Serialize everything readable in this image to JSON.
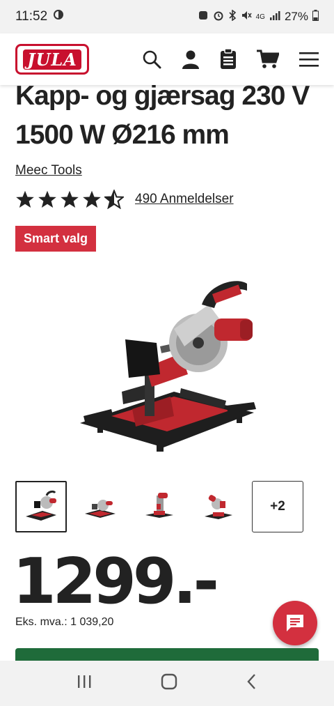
{
  "status_bar": {
    "time": "11:52",
    "network": "4G",
    "battery": "27%"
  },
  "header": {
    "logo_text": "JULA",
    "icons": [
      "search-icon",
      "user-icon",
      "clipboard-icon",
      "cart-icon",
      "menu-icon"
    ]
  },
  "product": {
    "title": "Kapp- og gjærsag 230 V 1500 W Ø216 mm",
    "brand": "Meec Tools",
    "rating_stars": 4.5,
    "reviews": "490 Anmeldelser",
    "badge": "Smart valg",
    "more_images": "+2",
    "price": "1299.-",
    "vat_price": "Eks. mva.: 1 039,20"
  },
  "colors": {
    "brand_red": "#c8102e",
    "badge_red": "#d3303f",
    "buy_green": "#1f6b3a"
  }
}
